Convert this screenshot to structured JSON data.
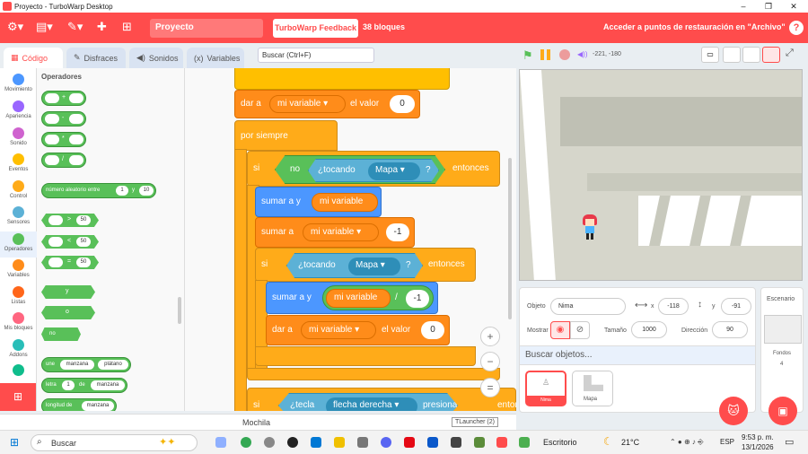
{
  "window": {
    "title": "Proyecto - TurboWarp Desktop",
    "controls": [
      "–",
      "❐",
      "✕"
    ]
  },
  "menubar": {
    "project_title": "Proyecto",
    "feedback_label": "TurboWarp Feedback",
    "blocks_count": "38 bloques",
    "restore_label": "Acceder a puntos de restauración en \"Archivo\"",
    "help_label": "?"
  },
  "tabs": [
    {
      "label": "Código",
      "icon": "code-icon",
      "active": true
    },
    {
      "label": "Disfraces",
      "icon": "brush-icon",
      "active": false
    },
    {
      "label": "Sonidos",
      "icon": "speaker-icon",
      "active": false
    },
    {
      "label": "Variables",
      "icon": "variables-icon",
      "active": false
    }
  ],
  "search": {
    "placeholder": "Buscar (Ctrl+F)"
  },
  "categories": [
    {
      "label": "Movimiento",
      "color": "#4c97ff"
    },
    {
      "label": "Apariencia",
      "color": "#9966ff"
    },
    {
      "label": "Sonido",
      "color": "#cf63cf"
    },
    {
      "label": "Eventos",
      "color": "#ffbf00"
    },
    {
      "label": "Control",
      "color": "#ffab19"
    },
    {
      "label": "Sensores",
      "color": "#5cb1d6"
    },
    {
      "label": "Operadores",
      "color": "#59c059"
    },
    {
      "label": "Variables",
      "color": "#ff8c1a"
    },
    {
      "label": "Listas",
      "color": "#ff661a"
    },
    {
      "label": "Mis bloques",
      "color": "#ff6680"
    },
    {
      "label": "Addons",
      "color": "#29beb8"
    }
  ],
  "palette": {
    "title": "Operadores",
    "arith_ops": [
      "+",
      "-",
      "*",
      "/"
    ],
    "random": {
      "label": "número aleatorio entre",
      "from": "1",
      "and": "y",
      "to": "10"
    },
    "compare": [
      {
        "op": ">",
        "val": "50"
      },
      {
        "op": "<",
        "val": "50"
      },
      {
        "op": "=",
        "val": "50"
      }
    ],
    "logic": [
      "y",
      "o",
      "no"
    ],
    "join": {
      "label": "une",
      "a": "manzana",
      "b": "plátano"
    },
    "letter": {
      "label": "letra",
      "n": "1",
      "of": "de",
      "word": "manzana"
    },
    "length": {
      "label": "longitud de",
      "word": "manzana"
    }
  },
  "script": {
    "set_var": {
      "label1": "dar a",
      "var": "mi variable",
      "label2": "el valor",
      "value": "0"
    },
    "forever": "por siempre",
    "if1": {
      "si": "si",
      "no": "no",
      "touching": "¿tocando",
      "target": "Mapa",
      "q": "?",
      "then": "entonces"
    },
    "change1": {
      "label": "sumar a y",
      "reporter": "mi variable"
    },
    "change2": {
      "label": "sumar a",
      "var": "mi variable",
      "value": "-1"
    },
    "if2": {
      "si": "si",
      "touching": "¿tocando",
      "target": "Mapa",
      "q": "?",
      "then": "entonces"
    },
    "change3": {
      "label": "sumar a y",
      "reporter": "mi variable",
      "op": "/",
      "value": "-1"
    },
    "set_var2": {
      "label1": "dar a",
      "var": "mi variable",
      "label2": "el valor",
      "value": "0"
    },
    "if3": {
      "si": "si",
      "key": "¿tecla",
      "keyname": "flecha derecha",
      "pressed": "presionada?",
      "then": "entonces"
    }
  },
  "zoom": {
    "in": "+",
    "out": "−",
    "reset": "="
  },
  "stage": {
    "coords": "-221, -180"
  },
  "sprite_info": {
    "object_label": "Objeto",
    "object_name": "Nima",
    "x_label": "x",
    "x": "-118",
    "y_label": "y",
    "y": "-91",
    "show_label": "Mostrar",
    "size_label": "Tamaño",
    "size": "1000",
    "direction_label": "Dirección",
    "direction": "90",
    "search_placeholder": "Buscar objetos...",
    "sprites": [
      {
        "name": "Nima",
        "selected": true
      },
      {
        "name": "Mapa",
        "selected": false
      }
    ]
  },
  "scene": {
    "title": "Escenario",
    "backdrops_label": "Fondos",
    "backdrops": "4"
  },
  "backpack": {
    "label": "Mochila",
    "tooltip": "TLauncher (2)"
  },
  "taskbar": {
    "search_label": "Buscar",
    "active_app": "Escritorio",
    "temp": "21°C",
    "lang": "ESP",
    "time": "9:53 p. m.",
    "date": "13/1/2026"
  }
}
